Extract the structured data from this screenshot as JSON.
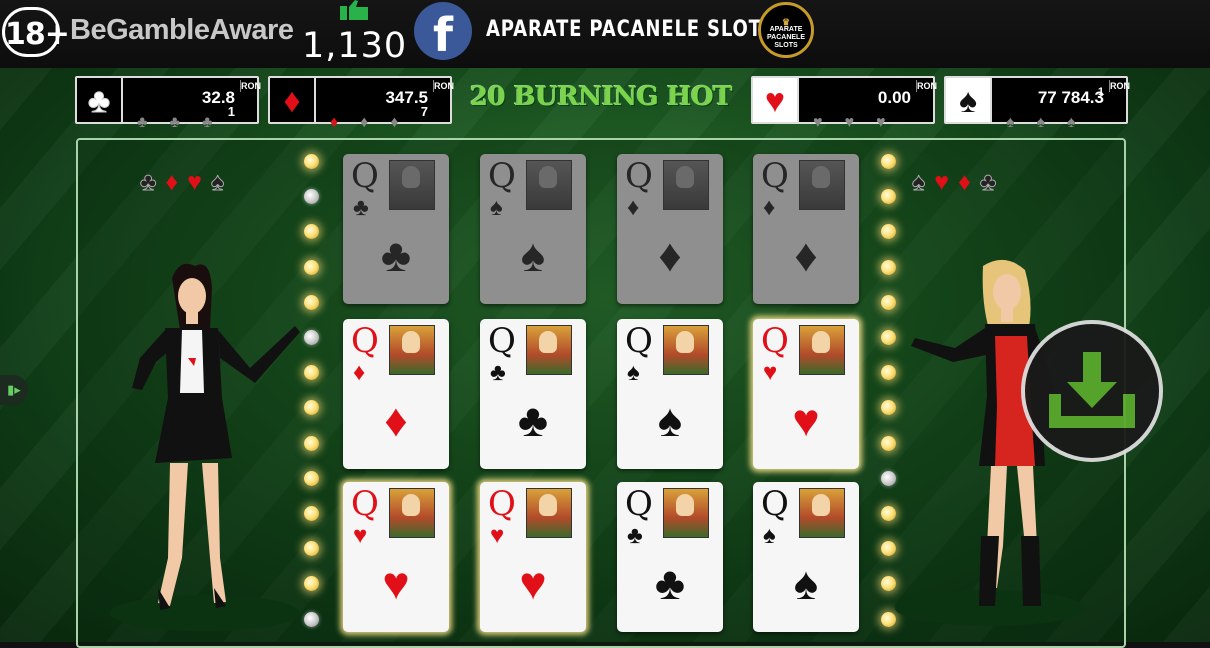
{
  "header": {
    "age_badge": "18+",
    "gamble_aware": "BeGambleAware",
    "like_count": "1,130",
    "facebook_letter": "f",
    "site_name": "APARATE PACANELE SLOTS",
    "site_logo_lines": [
      "APARATE",
      "PACANELE",
      "SLOTS"
    ]
  },
  "game": {
    "title": "20 BURNING HOT",
    "jackpots": [
      {
        "suit": "♣",
        "suit_color": "#111111",
        "value": "32.8",
        "small": "1",
        "currency": "RON"
      },
      {
        "suit": "♦",
        "suit_color": "#e10f17",
        "value": "347.5",
        "small": "7",
        "currency": "RON"
      },
      {
        "suit": "♥",
        "suit_color": "#e10f17",
        "value": "0.00",
        "small": "",
        "currency": "RON"
      },
      {
        "suit": "♠",
        "suit_color": "#111111",
        "value": "77 784.3",
        "small": "1",
        "currency": "RON"
      }
    ],
    "left_suits": [
      "♣",
      "♦",
      "♥",
      "♠"
    ],
    "right_suits": [
      "♠",
      "♥",
      "♦",
      "♣"
    ],
    "reels": [
      [
        {
          "rank": "Q",
          "suit": "♣",
          "color": "black",
          "state": "dim"
        },
        {
          "rank": "Q",
          "suit": "♦",
          "color": "red",
          "state": "normal"
        },
        {
          "rank": "Q",
          "suit": "♥",
          "color": "red",
          "state": "win"
        }
      ],
      [
        {
          "rank": "Q",
          "suit": "♠",
          "color": "black",
          "state": "dim"
        },
        {
          "rank": "Q",
          "suit": "♣",
          "color": "black",
          "state": "normal"
        },
        {
          "rank": "Q",
          "suit": "♥",
          "color": "red",
          "state": "win"
        }
      ],
      [
        {
          "rank": "Q",
          "suit": "♦",
          "color": "red",
          "state": "dim"
        },
        {
          "rank": "Q",
          "suit": "♠",
          "color": "black",
          "state": "normal"
        },
        {
          "rank": "Q",
          "suit": "♣",
          "color": "black",
          "state": "normal"
        }
      ],
      [
        {
          "rank": "Q",
          "suit": "♦",
          "color": "red",
          "state": "dim"
        },
        {
          "rank": "Q",
          "suit": "♥",
          "color": "red",
          "state": "win"
        },
        {
          "rank": "Q",
          "suit": "♠",
          "color": "black",
          "state": "normal"
        }
      ]
    ],
    "colors": {
      "title_green": "#7cd44a",
      "felt_green": "#1d5a22",
      "red_suit": "#e10f17",
      "download_green": "#5aa92d"
    },
    "download_icon": "download-icon"
  }
}
